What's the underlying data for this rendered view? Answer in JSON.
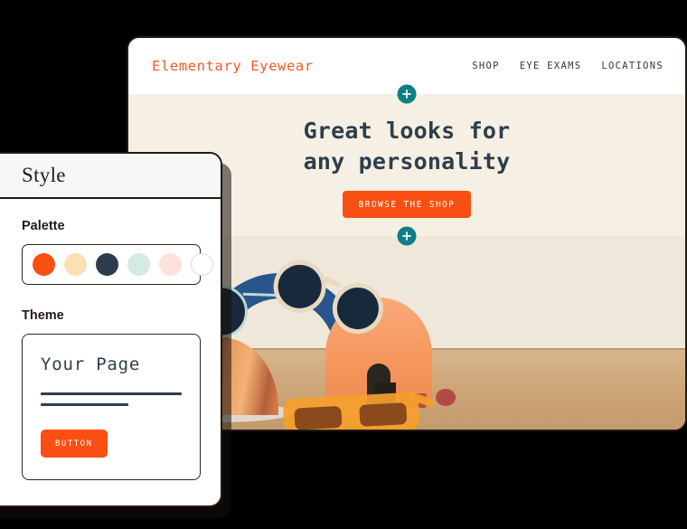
{
  "colors": {
    "accent_orange": "#FA4F12",
    "logo_orange": "#F4592B",
    "teal": "#0E7F86",
    "navy": "#2D3E4C",
    "cream": "#F6EFE3",
    "page_background": "#000000",
    "panel_border": "#231A15"
  },
  "site": {
    "logo": "Elementary Eyewear",
    "nav": [
      {
        "label": "SHOP"
      },
      {
        "label": "EYE EXAMS"
      },
      {
        "label": "LOCATIONS"
      }
    ],
    "hero": {
      "title_line1": "Great looks for",
      "title_line2": "any personality",
      "cta_label": "BROWSE THE SHOP"
    },
    "dividers": [
      {
        "icon": "plus-icon"
      },
      {
        "icon": "plus-icon"
      }
    ],
    "photo": {
      "alt": "Sunglasses arranged on a tan surface with a blue arch, orange arch and copper dome props"
    }
  },
  "style_panel": {
    "title": "Style",
    "palette": {
      "label": "Palette",
      "swatches": [
        {
          "name": "orange",
          "hex": "#FA4F12"
        },
        {
          "name": "cream",
          "hex": "#FBE0B4"
        },
        {
          "name": "navy",
          "hex": "#2B3C4C"
        },
        {
          "name": "mint",
          "hex": "#D4EAE5"
        },
        {
          "name": "blush",
          "hex": "#FBE3DA"
        },
        {
          "name": "white",
          "hex": "#FFFFFF"
        }
      ]
    },
    "theme": {
      "label": "Theme",
      "preview": {
        "title": "Your Page",
        "button_label": "BUTTON"
      }
    }
  }
}
